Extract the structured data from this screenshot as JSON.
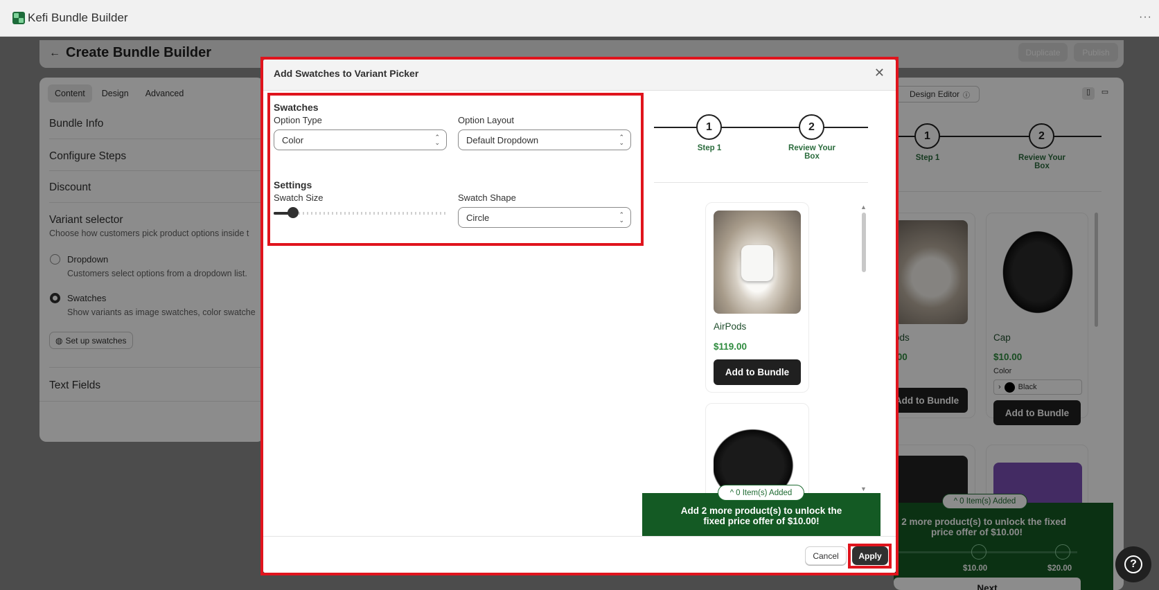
{
  "app": {
    "title": "Kefi Bundle Builder",
    "menu_icon": "more-horizontal-icon"
  },
  "page": {
    "title": "Create Bundle Builder",
    "duplicate": "Duplicate",
    "publish": "Publish"
  },
  "left_panel": {
    "tabs": [
      "Content",
      "Design",
      "Advanced"
    ],
    "sections": {
      "bundle_info": "Bundle Info",
      "configure_steps": "Configure Steps",
      "discount": "Discount",
      "variant_selector": "Variant selector",
      "text_fields": "Text Fields"
    },
    "variant_desc": "Choose how customers pick product options inside t",
    "dropdown_label": "Dropdown",
    "dropdown_desc": "Customers select options from a dropdown list.",
    "swatches_label": "Swatches",
    "swatches_desc": "Show variants as image swatches, color swatche",
    "setup_button": "Set up swatches"
  },
  "right_panel": {
    "design_editor": "Design Editor",
    "step1": "1",
    "step1_label": "Step 1",
    "step2": "2",
    "step2_label": "Review Your Box",
    "product1_name": "ods",
    "product1_price": ".00",
    "product2_name": "Cap",
    "product2_price": "$10.00",
    "color_label": "Color",
    "color_value": "Black",
    "add_label": "Add to Bundle",
    "items_added": "0 Item(s) Added",
    "banner": "dd 2 more product(s) to unlock the fixed price offer of $10.00!",
    "tier1": "$10.00",
    "tier2": "$20.00",
    "next": "Next"
  },
  "modal": {
    "title": "Add Swatches to Variant Picker",
    "swatches_heading": "Swatches",
    "option_type_label": "Option Type",
    "option_type_value": "Color",
    "option_layout_label": "Option Layout",
    "option_layout_value": "Default Dropdown",
    "settings_heading": "Settings",
    "swatch_size_label": "Swatch Size",
    "swatch_size_value": 0.1,
    "swatch_shape_label": "Swatch Shape",
    "swatch_shape_value": "Circle",
    "preview": {
      "step1": "1",
      "step1_label": "Step 1",
      "step2": "2",
      "step2_label": "Review Your Box",
      "product1_name": "AirPods",
      "product1_price": "$119.00",
      "add_label": "Add to Bundle",
      "items_added": "0 Item(s) Added",
      "banner": "Add 2 more product(s) to unlock the fixed price offer of $10.00!"
    },
    "cancel": "Cancel",
    "apply": "Apply"
  },
  "colors": {
    "accent_green": "#145a24",
    "highlight": "#e0141d",
    "dark": "#202020"
  }
}
